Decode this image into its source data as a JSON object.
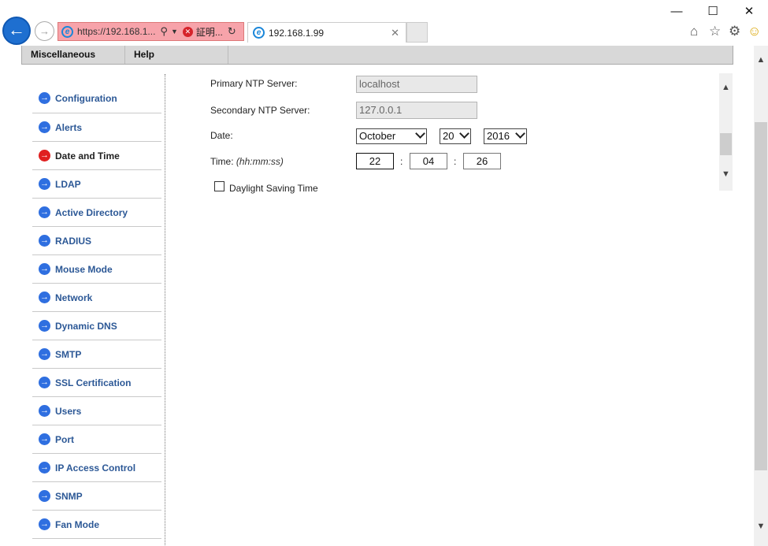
{
  "browser": {
    "url_display": "https://192.168.1...",
    "cert_error_label": "証明...",
    "tab_title": "192.168.1.99"
  },
  "menu": {
    "items": [
      "Miscellaneous",
      "Help"
    ]
  },
  "sidebar": {
    "items": [
      {
        "label": "Configuration",
        "active": false
      },
      {
        "label": "Alerts",
        "active": false
      },
      {
        "label": "Date and Time",
        "active": true
      },
      {
        "label": "LDAP",
        "active": false
      },
      {
        "label": "Active Directory",
        "active": false
      },
      {
        "label": "RADIUS",
        "active": false
      },
      {
        "label": "Mouse Mode",
        "active": false
      },
      {
        "label": "Network",
        "active": false
      },
      {
        "label": "Dynamic DNS",
        "active": false
      },
      {
        "label": "SMTP",
        "active": false
      },
      {
        "label": "SSL Certification",
        "active": false
      },
      {
        "label": "Users",
        "active": false
      },
      {
        "label": "Port",
        "active": false
      },
      {
        "label": "IP Access Control",
        "active": false
      },
      {
        "label": "SNMP",
        "active": false
      },
      {
        "label": "Fan Mode",
        "active": false
      }
    ]
  },
  "form": {
    "primary_ntp_label": "Primary NTP Server:",
    "primary_ntp_value": "localhost",
    "secondary_ntp_label": "Secondary NTP Server:",
    "secondary_ntp_value": "127.0.0.1",
    "date_label": "Date:",
    "month": "October",
    "day": "20",
    "year": "2016",
    "time_label": "Time:",
    "time_hint": "(hh:mm:ss)",
    "hour": "22",
    "minute": "04",
    "second": "26",
    "colon": ":",
    "dst_label": "Daylight Saving Time",
    "dst_checked": false
  }
}
